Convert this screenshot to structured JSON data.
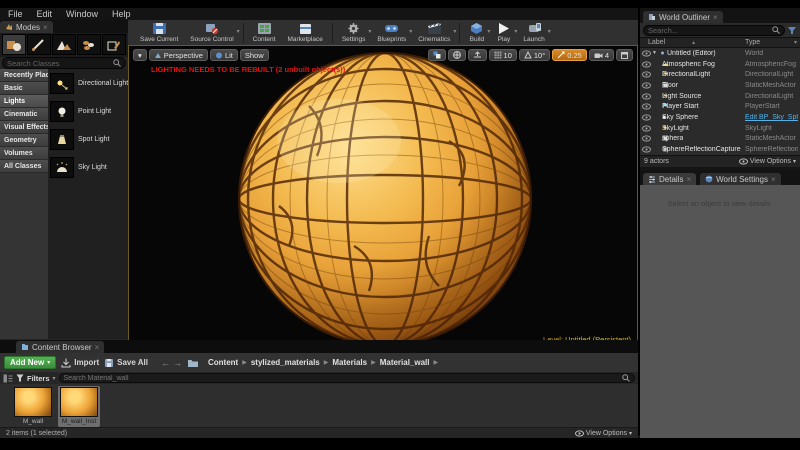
{
  "menu": {
    "items": [
      "File",
      "Edit",
      "Window",
      "Help"
    ]
  },
  "modes_panel": {
    "tab_label": "Modes",
    "search_placeholder": "Search Classes",
    "categories": [
      "Recently Placed",
      "Basic",
      "Lights",
      "Cinematic",
      "Visual Effects",
      "Geometry",
      "Volumes",
      "All Classes"
    ],
    "selected_category": "Lights",
    "items": [
      "Directional Light",
      "Point Light",
      "Spot Light",
      "Sky Light"
    ]
  },
  "toolbar": {
    "save_current": "Save Current",
    "source_control": "Source Control",
    "content": "Content",
    "marketplace": "Marketplace",
    "settings": "Settings",
    "blueprints": "Blueprints",
    "cinematics": "Cinematics",
    "build": "Build",
    "play": "Play",
    "launch": "Launch"
  },
  "viewport": {
    "perspective_label": "Perspective",
    "lit_label": "Lit",
    "show_label": "Show",
    "warning": "LIGHTING NEEDS TO BE REBUILT (2 unbuilt object(s))",
    "level_label": "Level:",
    "level_value": "Untitled (Persistent)",
    "grid_snap": "10",
    "rotation_snap": "10°",
    "scale_snap": "0.25",
    "camera_speed": "4"
  },
  "outliner": {
    "tab_label": "World Outliner",
    "search_placeholder": "Search...",
    "col_label": "Label",
    "col_type": "Type",
    "rows": [
      {
        "label": "Untitled (Editor)",
        "type": "World"
      },
      {
        "label": "Atmospheric Fog",
        "type": "AtmosphericFog"
      },
      {
        "label": "DirectionalLight",
        "type": "DirectionalLight"
      },
      {
        "label": "Floor",
        "type": "StaticMeshActor"
      },
      {
        "label": "Light Source",
        "type": "DirectionalLight"
      },
      {
        "label": "Player Start",
        "type": "PlayerStart"
      },
      {
        "label": "Sky Sphere",
        "type": "Edit BP_Sky_Sph"
      },
      {
        "label": "SkyLight",
        "type": "SkyLight"
      },
      {
        "label": "sphera",
        "type": "StaticMeshActor"
      },
      {
        "label": "SphereReflectionCapture",
        "type": "SphereReflectionC"
      }
    ],
    "footer_count": "9 actors",
    "view_options_label": "View Options"
  },
  "details_panel": {
    "tab_details": "Details",
    "tab_world_settings": "World Settings",
    "empty_message": "Select an object to view details."
  },
  "content_browser": {
    "tab_label": "Content Browser",
    "add_new_label": "Add New",
    "import_label": "Import",
    "save_all_label": "Save All",
    "breadcrumbs": [
      "Content",
      "stylized_materials",
      "Materials",
      "Material_wall"
    ],
    "filters_label": "Filters",
    "search_placeholder": "Search Material_wall",
    "assets": [
      {
        "name": "M_wall"
      },
      {
        "name": "M_wall_Inst"
      }
    ],
    "status": "2 items (1 selected)",
    "view_options_label": "View Options"
  },
  "colors": {
    "accent_green": "#47a347",
    "warning_red": "#e41212",
    "viewport_border_gold": "#6b5d18",
    "level_text_gold": "#c3a021",
    "link_blue": "#55b1e8"
  }
}
